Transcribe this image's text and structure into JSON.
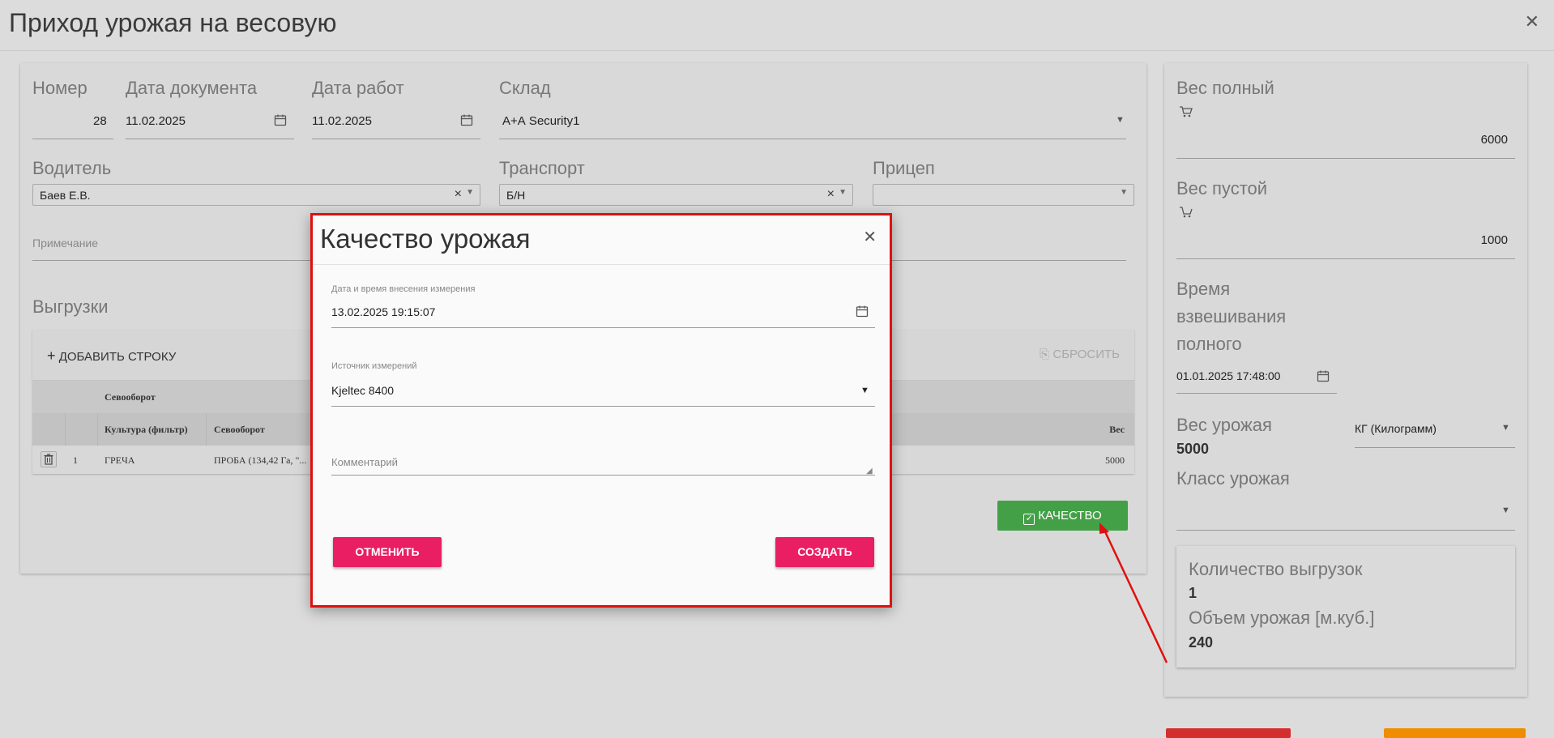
{
  "page": {
    "title": "Приход урожая на весовую",
    "close_icon": "close-icon"
  },
  "form": {
    "number_label": "Номер",
    "number_value": "28",
    "doc_date_label": "Дата документа",
    "doc_date_value": "11.02.2025",
    "work_date_label": "Дата работ",
    "work_date_value": "11.02.2025",
    "warehouse_label": "Склад",
    "warehouse_value": "А+А Security1",
    "driver_label": "Водитель",
    "driver_value": "Баев Е.В.",
    "transport_label": "Транспорт",
    "transport_value": "Б/Н",
    "trailer_label": "Прицеп",
    "trailer_value": "",
    "note_placeholder": "Примечание",
    "unloads_title": "Выгрузки"
  },
  "grid": {
    "add_row_label": "ДОБАВИТЬ СТРОКУ",
    "reset_label": "СБРОСИТЬ",
    "group_header": "Севооборот",
    "columns": [
      "Культура (фильтр)",
      "Севооборот",
      "Вес"
    ],
    "rows": [
      {
        "num": "1",
        "culture": "ГРЕЧА",
        "rotation": "ПРОБА (134,42 Га, \"...",
        "weight": "5000"
      }
    ]
  },
  "quality_button_label": "КАЧЕСТВО",
  "side": {
    "gross_label": "Вес полный",
    "gross_value": "6000",
    "tare_label": "Вес пустой",
    "tare_value": "1000",
    "time_label_1": "Время",
    "time_label_2": "взвешивания",
    "time_label_3": "полного",
    "time_value": "01.01.2025 17:48:00",
    "yield_weight_label": "Вес урожая",
    "yield_weight_value": "5000",
    "unit_value": "КГ (Килограмм)",
    "class_label": "Класс урожая",
    "class_value": "",
    "unloads_count_label": "Количество выгрузок",
    "unloads_count_value": "1",
    "volume_label": "Объем урожая [м.куб.]",
    "volume_value": "240"
  },
  "dialog": {
    "title": "Качество урожая",
    "datetime_label": "Дата и время внесения измерения",
    "datetime_value": "13.02.2025 19:15:07",
    "source_label": "Источник измерений",
    "source_value": "Kjeltec 8400",
    "comment_placeholder": "Комментарий",
    "cancel_label": "ОТМЕНИТЬ",
    "create_label": "СОЗДАТЬ"
  },
  "colors": {
    "accent_pink": "#e91e63",
    "accent_green": "#43a047",
    "highlight_red": "#e01010",
    "bottom_red": "#d32f2f",
    "bottom_orange": "#ef8c00"
  }
}
